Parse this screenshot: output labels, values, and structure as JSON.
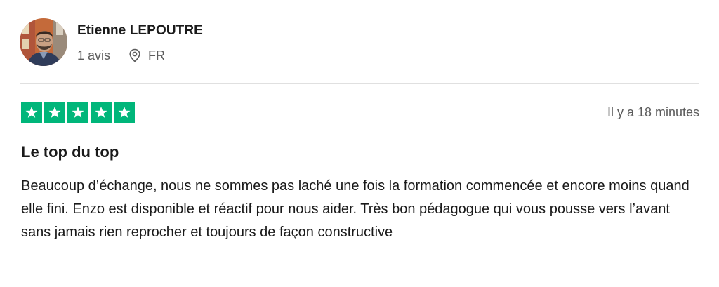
{
  "reviewer": {
    "name": "Etienne LEPOUTRE",
    "review_count": "1 avis",
    "country": "FR"
  },
  "rating": {
    "stars": 5,
    "max_stars": 5,
    "star_color": "#00b67a"
  },
  "review": {
    "date": "Il y a 18 minutes",
    "title": "Le top du top",
    "body": "Beaucoup d’échange, nous ne sommes pas laché une fois la formation commencée et encore moins quand elle fini. Enzo est disponible et réactif pour nous aider. Très bon pédagogue qui vous pousse vers l’avant sans jamais rien reprocher et toujours de façon constructive"
  },
  "icons": {
    "location": "map-pin-icon",
    "star": "star-icon"
  }
}
